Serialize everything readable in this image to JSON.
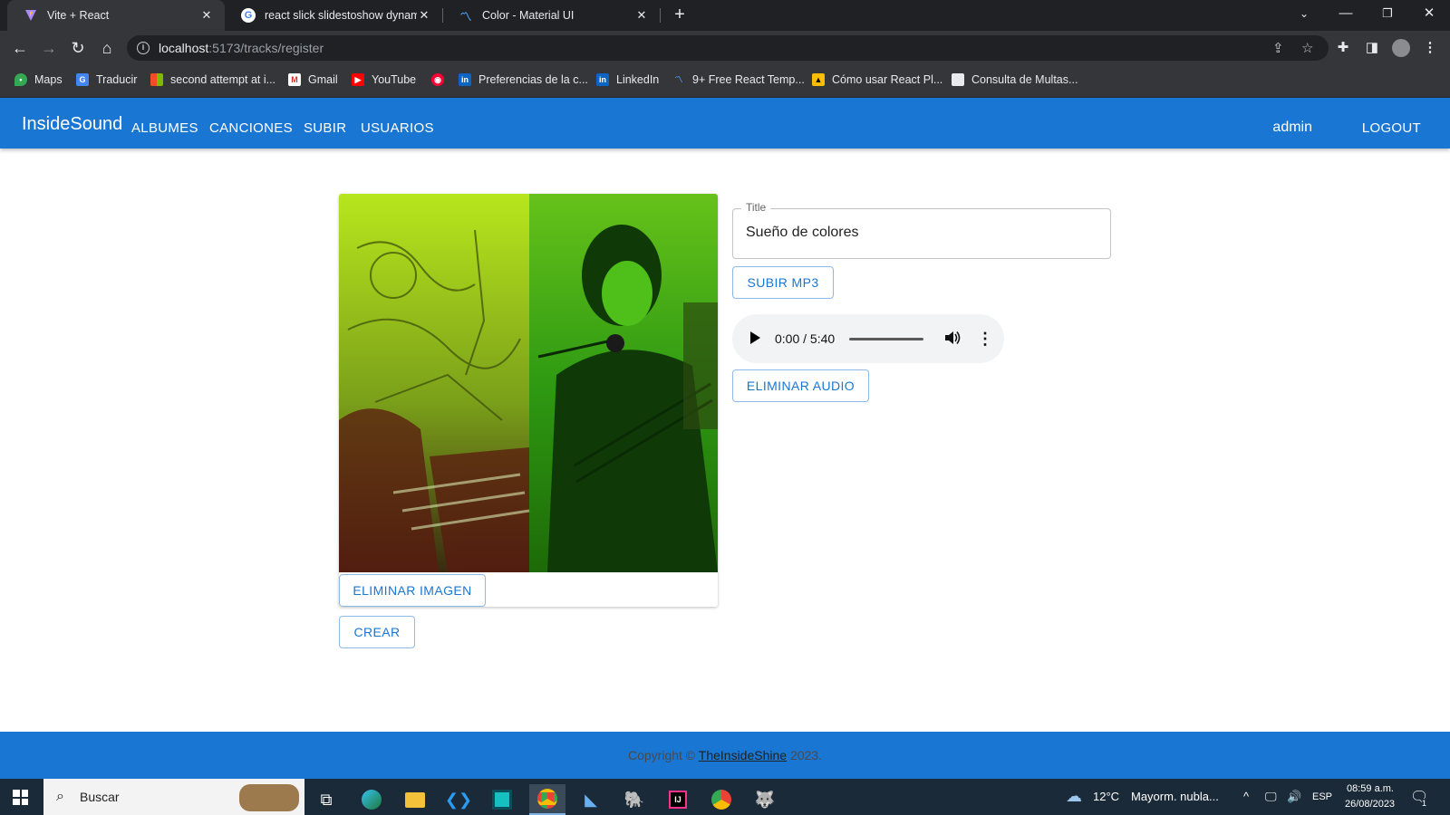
{
  "browser": {
    "tabs": [
      {
        "title": "Vite + React",
        "icon": "vite-icon"
      },
      {
        "title": "react slick slidestoshow dynamic",
        "icon": "google-icon"
      },
      {
        "title": "Color - Material UI",
        "icon": "mui-icon"
      }
    ],
    "url_host": "localhost",
    "url_path": ":5173/tracks/register",
    "bookmarks": [
      "Maps",
      "Traducir",
      "second attempt at i...",
      "Gmail",
      "YouTube",
      "",
      "Preferencias de la c...",
      "LinkedIn",
      "9+ Free React Temp...",
      "Cómo usar React Pl...",
      "Consulta de Multas..."
    ]
  },
  "appbar": {
    "brand": "InsideSound",
    "nav": [
      "ALBUMES",
      "CANCIONES",
      "SUBIR",
      "USUARIOS"
    ],
    "user": "admin",
    "logout": "LOGOUT"
  },
  "form": {
    "delete_image": "ELIMINAR IMAGEN",
    "create": "CREAR",
    "title_label": "Title",
    "title_value": "Sueño de colores",
    "upload_mp3": "SUBIR MP3",
    "audio_time": "0:00 / 5:40",
    "delete_audio": "ELIMINAR AUDIO"
  },
  "footer": {
    "prefix": "Copyright © ",
    "link": "TheInsideShine",
    "suffix": " 2023."
  },
  "taskbar": {
    "search_placeholder": "Buscar",
    "temperature": "12°C",
    "weather": "Mayorm. nubla...",
    "language": "ESP",
    "time": "08:59 a.m.",
    "date": "26/08/2023",
    "notification_count": "1"
  },
  "colors": {
    "primary": "#1976d2",
    "chrome_dark": "#202124",
    "chrome_toolbar": "#35363a",
    "taskbar": "#1b2a38"
  }
}
